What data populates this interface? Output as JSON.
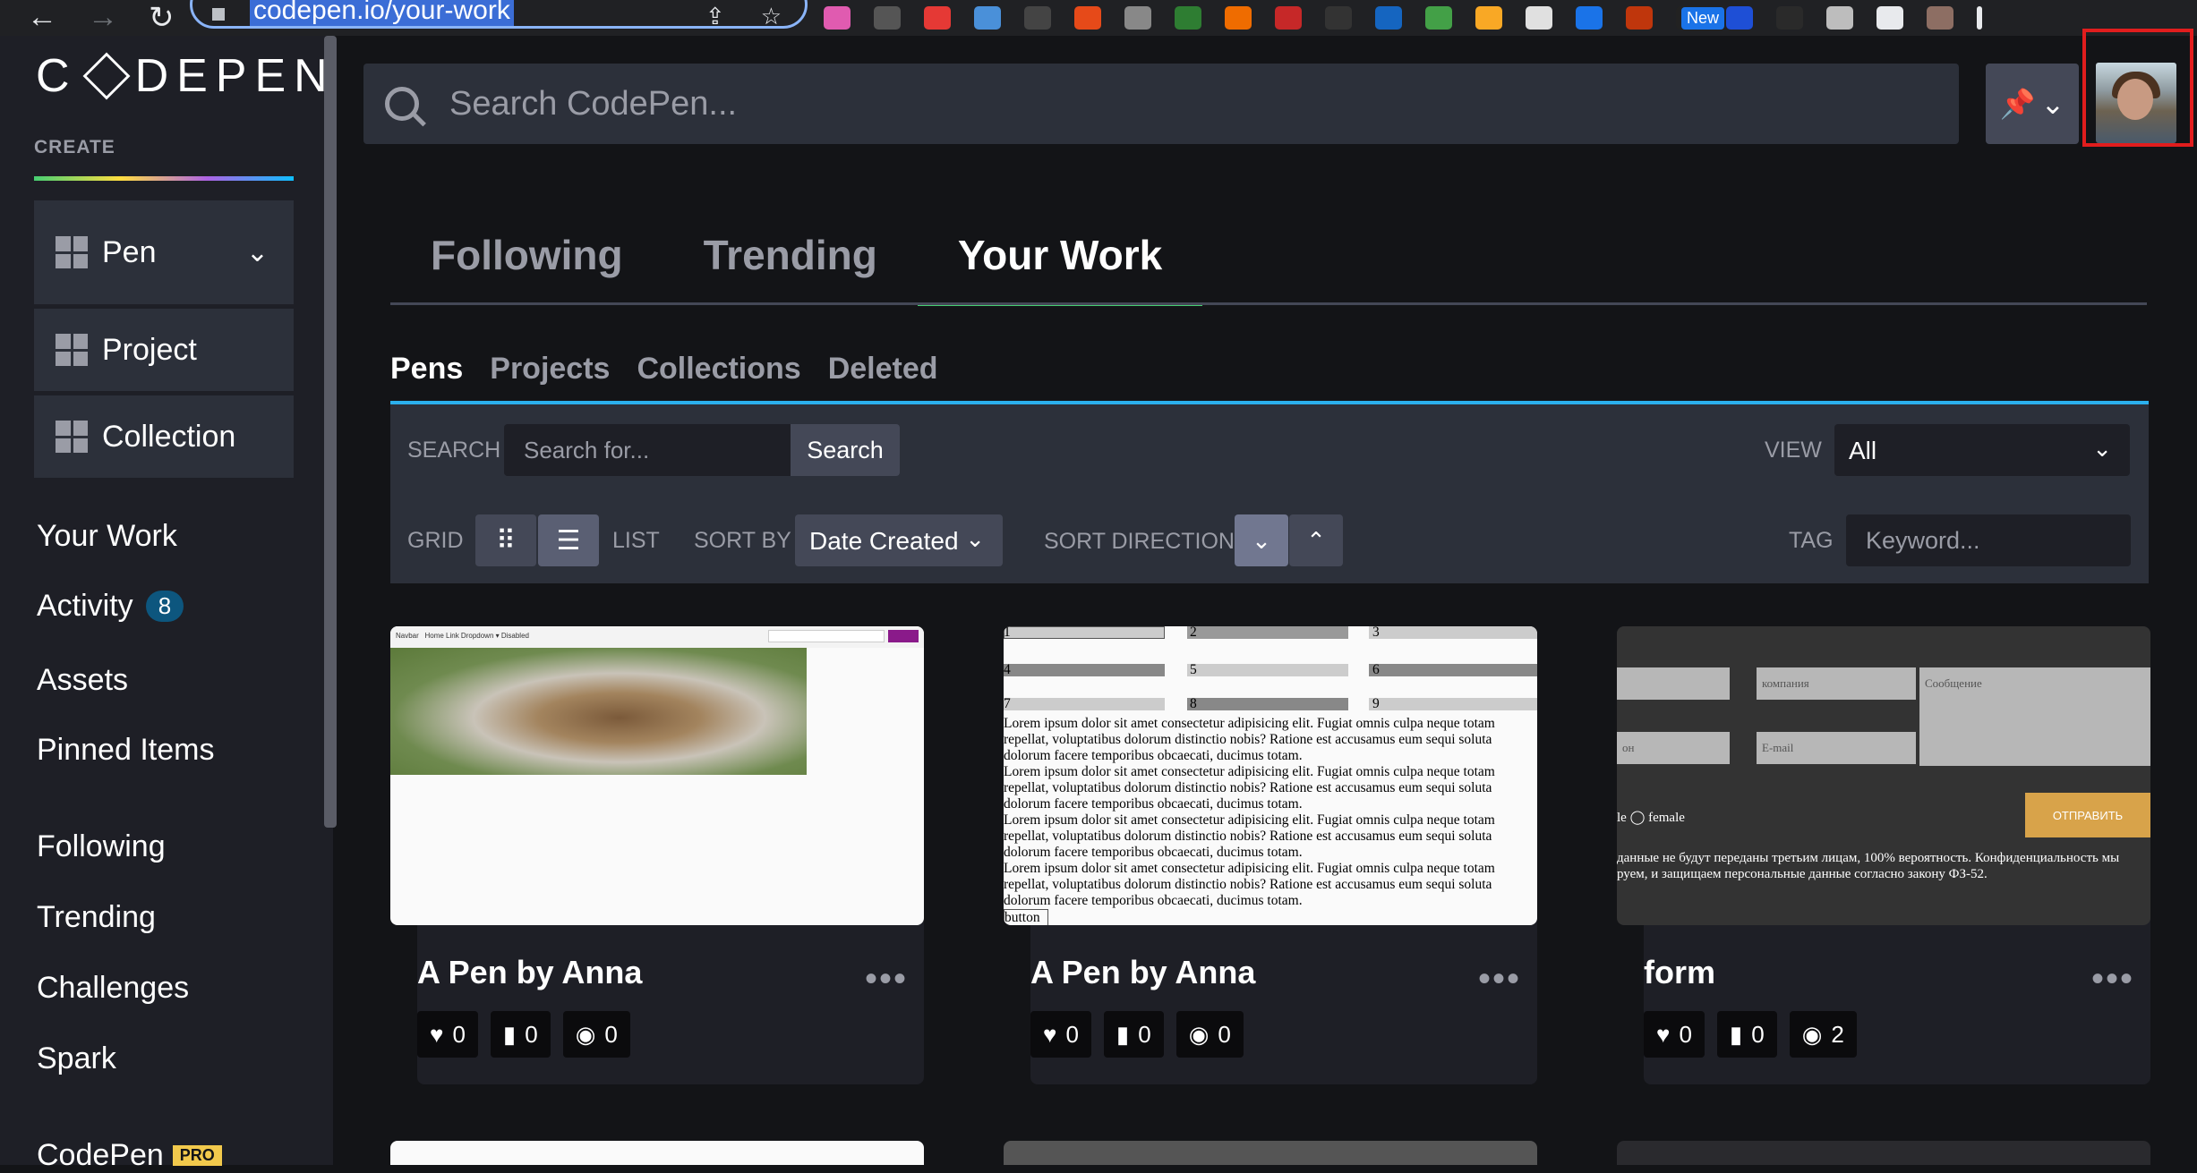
{
  "browser": {
    "url": "codepen.io/your-work",
    "new_badge": "New"
  },
  "brand": {
    "logo_left": "C",
    "logo_right": "DEPEN"
  },
  "sidebar": {
    "create_label": "CREATE",
    "create_buttons": [
      {
        "label": "Pen"
      },
      {
        "label": "Project"
      },
      {
        "label": "Collection"
      }
    ],
    "nav": [
      {
        "label": "Your Work"
      },
      {
        "label": "Activity",
        "badge": "8"
      },
      {
        "label": "Assets"
      },
      {
        "label": "Pinned Items"
      },
      {
        "label": "Following"
      },
      {
        "label": "Trending"
      },
      {
        "label": "Challenges"
      },
      {
        "label": "Spark"
      }
    ],
    "partial_item": "CodePen",
    "pro_badge": "PRO"
  },
  "header": {
    "search_placeholder": "Search CodePen..."
  },
  "tabs": [
    "Following",
    "Trending",
    "Your Work"
  ],
  "subtabs": [
    "Pens",
    "Projects",
    "Collections",
    "Deleted"
  ],
  "filters": {
    "search_label": "SEARCH",
    "search_placeholder": "Search for...",
    "search_button": "Search",
    "view_label": "VIEW",
    "view_value": "All",
    "grid_label": "GRID",
    "list_label": "LIST",
    "sort_by_label": "SORT BY",
    "sort_by_value": "Date Created",
    "sort_direction_label": "SORT DIRECTION",
    "tag_label": "TAG",
    "tag_placeholder": "Keyword..."
  },
  "cards": [
    {
      "title": "A Pen by Anna",
      "likes": "0",
      "comments": "0",
      "views": "0"
    },
    {
      "title": "A Pen by Anna",
      "likes": "0",
      "comments": "0",
      "views": "0"
    },
    {
      "title": "form",
      "likes": "0",
      "comments": "0",
      "views": "2"
    }
  ],
  "thumb1": {
    "brand": "Navbar",
    "links": "Home  Link  Dropdown ▾  Disabled",
    "search": "Search",
    "button": "Search"
  },
  "thumb2": {
    "labels": [
      "1",
      "2",
      "3",
      "4",
      "5",
      "6",
      "7",
      "8",
      "9"
    ],
    "lorem": "Lorem ipsum dolor sit amet consectetur adipisicing elit. Fugiat omnis culpa neque totam repellat, voluptatibus dolorum distinctio nobis? Ratione est accusamus eum sequi soluta dolorum facere temporibus obcaecati, ducimus totam.",
    "button": "button"
  },
  "thumb3": {
    "company": "компания",
    "message": "Сообщение",
    "email": "E-mail",
    "phone": "он",
    "gender": "le ◯ female",
    "submit": "ОТПРАВИТЬ",
    "note": "данные не будут переданы третьим лицам, 100% вероятность. Конфиденциальность мы руем, и защищаем персональные данные согласно закону ФЗ-52."
  }
}
